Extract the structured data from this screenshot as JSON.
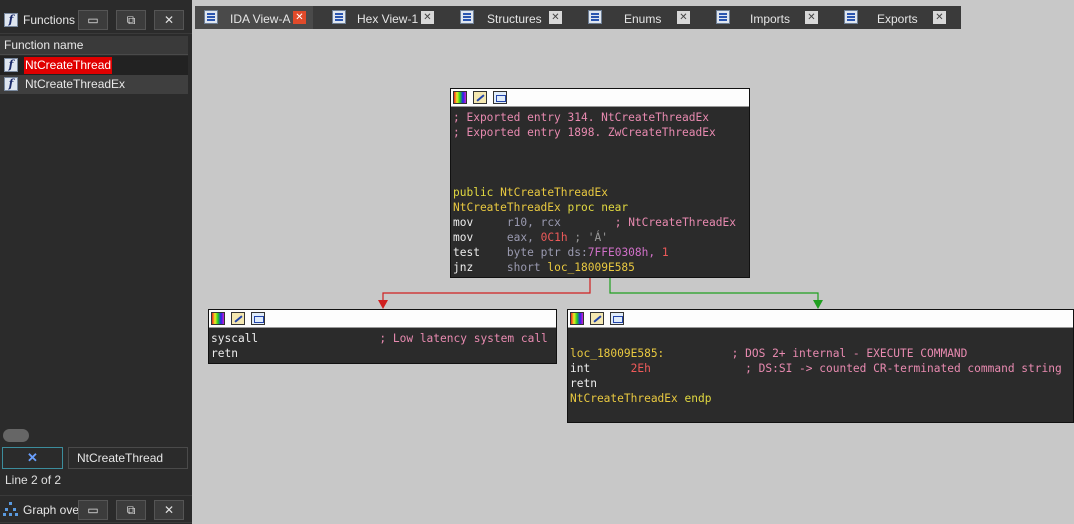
{
  "functions_pane": {
    "title": "Functions",
    "column_header": "Function name",
    "items": [
      {
        "name": "NtCreateThread",
        "selected": true
      },
      {
        "name": "NtCreateThreadEx",
        "selected": false
      }
    ],
    "filter_value": "NtCreateThread",
    "status": "Line 2 of 2"
  },
  "graph_overview": {
    "title": "Graph ove"
  },
  "window_buttons": {
    "minimize": "▭",
    "restore": "⧉",
    "close": "✕"
  },
  "tabs": [
    {
      "label": "IDA View-A",
      "icon": "ida-view-icon",
      "active": true
    },
    {
      "label": "Hex View-1",
      "icon": "hex-view-icon",
      "active": false
    },
    {
      "label": "Structures",
      "icon": "structures-icon",
      "active": false
    },
    {
      "label": "Enums",
      "icon": "enums-icon",
      "active": false
    },
    {
      "label": "Imports",
      "icon": "imports-icon",
      "active": false
    },
    {
      "label": "Exports",
      "icon": "exports-icon",
      "active": false
    }
  ],
  "graph": {
    "main_block": {
      "comment1": "; Exported entry 314. NtCreateThreadEx",
      "comment2": "; Exported entry 1898. ZwCreateThreadEx",
      "public_kw": "public",
      "public_name": "NtCreateThreadEx",
      "proc_name": "NtCreateThreadEx",
      "proc_kw": "proc near",
      "mov1_op": "mov",
      "mov1_dst": "r10,",
      "mov1_src": "rcx",
      "mov1_comment": "; NtCreateThreadEx",
      "mov2_op": "mov",
      "mov2_dst": "eax,",
      "mov2_num": "0C1h",
      "mov2_comment": "; 'Á'",
      "test_op": "test",
      "test_arg1": "byte ptr",
      "test_seg": "ds:",
      "test_addr": "7FFE0308h,",
      "test_imm": "1",
      "jnz_op": "jnz",
      "jnz_kw": "short",
      "jnz_target": "loc_18009E585"
    },
    "left_block": {
      "syscall_op": "syscall",
      "syscall_comment": "; Low latency system call",
      "retn_op": "retn"
    },
    "right_block": {
      "label": "loc_18009E585:",
      "label_comment": "; DOS 2+ internal - EXECUTE COMMAND",
      "int_op": "int",
      "int_num": "2Eh",
      "int_comment": "; DS:SI -> counted CR-terminated command string",
      "retn_op": "retn",
      "endp_name": "NtCreateThreadEx",
      "endp_kw": "endp"
    },
    "edge_colors": {
      "false_branch": "#d02020",
      "true_branch": "#20a020"
    }
  }
}
